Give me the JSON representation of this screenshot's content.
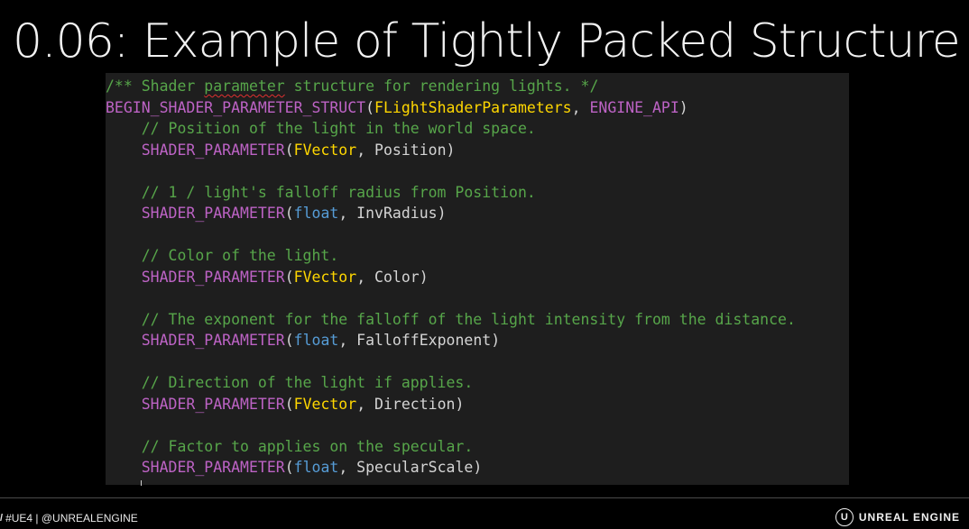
{
  "slide": {
    "title": "0.06: Example of Tightly Packed Structure"
  },
  "code": {
    "lines": [
      [
        {
          "t": "/** Shader ",
          "c": "comment"
        },
        {
          "t": "parameter",
          "c": "comment squiggle"
        },
        {
          "t": " structure for rendering lights. */",
          "c": "comment"
        }
      ],
      [
        {
          "t": "BEGIN_SHADER_PARAMETER_STRUCT",
          "c": "macro"
        },
        {
          "t": "(",
          "c": "plain"
        },
        {
          "t": "FLightShaderParameters",
          "c": "type"
        },
        {
          "t": ", ",
          "c": "plain"
        },
        {
          "t": "ENGINE_API",
          "c": "api"
        },
        {
          "t": ")",
          "c": "plain"
        }
      ],
      [
        {
          "t": "    // Position of the light in the world space.",
          "c": "comment"
        }
      ],
      [
        {
          "t": "    ",
          "c": "plain"
        },
        {
          "t": "SHADER_PARAMETER",
          "c": "macro"
        },
        {
          "t": "(",
          "c": "plain"
        },
        {
          "t": "FVector",
          "c": "type"
        },
        {
          "t": ", Position)",
          "c": "plain"
        }
      ],
      [],
      [
        {
          "t": "    // 1 / light's falloff radius from Position.",
          "c": "comment"
        }
      ],
      [
        {
          "t": "    ",
          "c": "plain"
        },
        {
          "t": "SHADER_PARAMETER",
          "c": "macro"
        },
        {
          "t": "(",
          "c": "plain"
        },
        {
          "t": "float",
          "c": "keyword"
        },
        {
          "t": ", InvRadius)",
          "c": "plain"
        }
      ],
      [],
      [
        {
          "t": "    // Color of the light.",
          "c": "comment"
        }
      ],
      [
        {
          "t": "    ",
          "c": "plain"
        },
        {
          "t": "SHADER_PARAMETER",
          "c": "macro"
        },
        {
          "t": "(",
          "c": "plain"
        },
        {
          "t": "FVector",
          "c": "type"
        },
        {
          "t": ", Color)",
          "c": "plain"
        }
      ],
      [],
      [
        {
          "t": "    // The exponent for the falloff of the light intensity from the distance.",
          "c": "comment"
        }
      ],
      [
        {
          "t": "    ",
          "c": "plain"
        },
        {
          "t": "SHADER_PARAMETER",
          "c": "macro"
        },
        {
          "t": "(",
          "c": "plain"
        },
        {
          "t": "float",
          "c": "keyword"
        },
        {
          "t": ", FalloffExponent)",
          "c": "plain"
        }
      ],
      [],
      [
        {
          "t": "    // Direction of the light if applies.",
          "c": "comment"
        }
      ],
      [
        {
          "t": "    ",
          "c": "plain"
        },
        {
          "t": "SHADER_PARAMETER",
          "c": "macro"
        },
        {
          "t": "(",
          "c": "plain"
        },
        {
          "t": "FVector",
          "c": "type"
        },
        {
          "t": ", Direction)",
          "c": "plain"
        }
      ],
      [],
      [
        {
          "t": "    // Factor to applies on the specular.",
          "c": "comment"
        }
      ],
      [
        {
          "t": "    ",
          "c": "plain"
        },
        {
          "t": "SHADER_PARAMETER",
          "c": "macro"
        },
        {
          "t": "(",
          "c": "plain"
        },
        {
          "t": "float",
          "c": "keyword"
        },
        {
          "t": ", SpecularScale)",
          "c": "plain"
        }
      ]
    ]
  },
  "footer": {
    "hashtag_icon": "twitter-hash-icon",
    "left_text": "#UE4 | @UNREALENGINE",
    "logo_icon": "unreal-engine-logo-icon",
    "logo_glyph": "U",
    "brand_text": "UNREAL ENGINE"
  },
  "colors": {
    "background": "#000000",
    "editor_background": "#1e1e1e",
    "comment": "#57a64a",
    "macro": "#bd63c5",
    "type": "#ffd700",
    "keyword": "#569cd6",
    "plain": "#d4d4d4"
  }
}
